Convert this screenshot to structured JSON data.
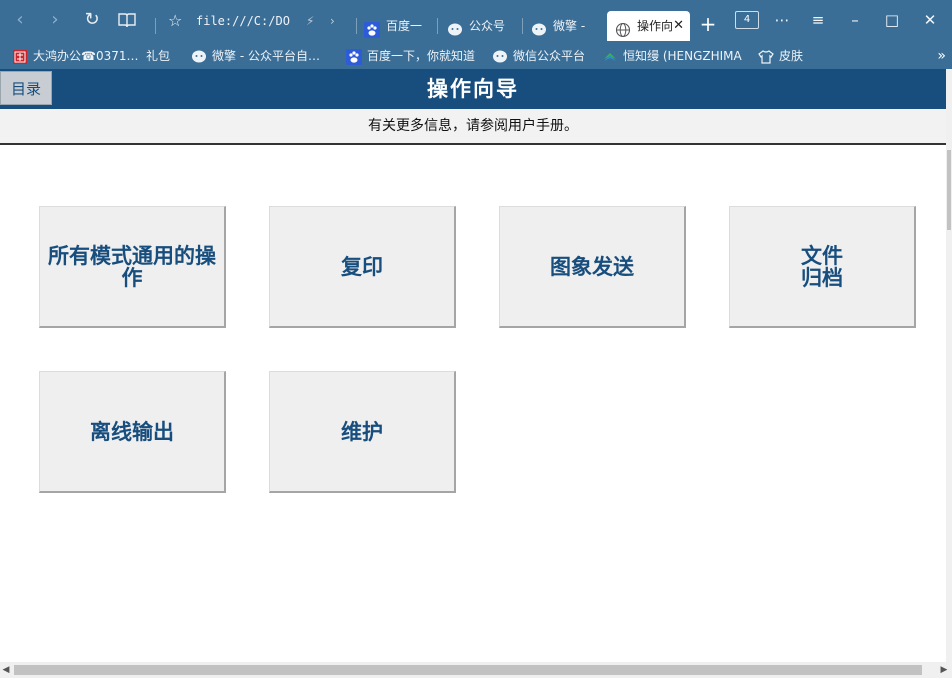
{
  "browser": {
    "address": "file:///C:/DO",
    "tabs": [
      {
        "label": "百度一",
        "icon": "paw-icon"
      },
      {
        "label": "公众号",
        "icon": "wechat-icon"
      },
      {
        "label": "微擎 -",
        "icon": "wechat-icon"
      },
      {
        "label": "操作向",
        "icon": "globe-icon",
        "active": true
      }
    ],
    "tab_count": "4",
    "bookmarks": [
      {
        "label": "大鸿办公☎0371…",
        "icon": "seal-icon"
      },
      {
        "label": "礼包",
        "icon": ""
      },
      {
        "label": "微擎 - 公众平台自…",
        "icon": "wechat-icon"
      },
      {
        "label": "百度一下，你就知道",
        "icon": "paw-icon"
      },
      {
        "label": "微信公众平台",
        "icon": "wechat-icon"
      },
      {
        "label": "恒知缦 (HENGZHIMAN…",
        "icon": "leaf-icon"
      },
      {
        "label": "皮肤",
        "icon": "shirt-icon"
      }
    ]
  },
  "header": {
    "toc_label": "目录",
    "title": "操作向导",
    "info": "有关更多信息，请参阅用户手册。"
  },
  "tiles": [
    {
      "label": "所有模式通用的操作"
    },
    {
      "label": "复印"
    },
    {
      "label": "图象发送"
    },
    {
      "label": "文件\n归档"
    },
    {
      "label": "离线输出"
    },
    {
      "label": "维护"
    }
  ],
  "colors": {
    "chrome": "#3a6e96",
    "header": "#184e7e",
    "tile_text": "#184e7e",
    "tile_bg": "#efefef"
  }
}
